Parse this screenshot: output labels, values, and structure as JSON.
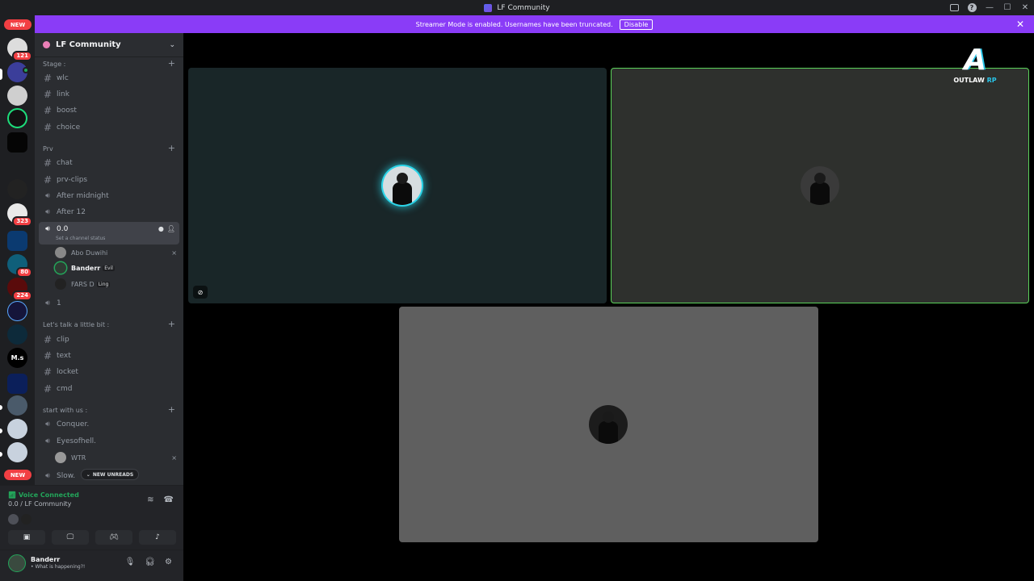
{
  "window": {
    "title": "LF Community"
  },
  "banner": {
    "message": "Streamer Mode is enabled. Usernames have been truncated.",
    "disable_label": "Disable"
  },
  "rail": {
    "new_top": "NEW",
    "new_bottom": "NEW",
    "badges": [
      "121",
      "323",
      "80",
      "224"
    ],
    "text_server": "M.s"
  },
  "server": {
    "name": "LF Community"
  },
  "categories": [
    {
      "name": "Stage :"
    },
    {
      "name": "Prv"
    },
    {
      "name": "Let's talk a little bit :"
    },
    {
      "name": "start with us :"
    }
  ],
  "channels": {
    "stage": [
      "wlc",
      "link",
      "boost",
      "choice"
    ],
    "prv_text": [
      "chat",
      "prv-clips"
    ],
    "prv_voice": [
      "After midnight",
      "After 12"
    ],
    "active": {
      "name": "0.0",
      "status": "Set a channel status"
    },
    "voice_users": [
      {
        "name": "Abo Duwihi",
        "tag": ""
      },
      {
        "name": "Banderr",
        "tag": "Evil"
      },
      {
        "name": "FARS D",
        "tag": "Ling"
      }
    ],
    "after_active": "1",
    "talk": [
      "clip",
      "text",
      "locket",
      "cmd"
    ],
    "start_voice": [
      "Conquer.",
      "Eyesofhell."
    ],
    "start_user": "WTR",
    "last": "Slow."
  },
  "new_unreads": "NEW UNREADS",
  "voice_panel": {
    "status": "Voice Connected",
    "channel": "0.0 / LF Community"
  },
  "user_panel": {
    "name": "Banderr",
    "status": "• What is happening?!"
  },
  "logo": {
    "main": "OUTLAW",
    "accent": "RP"
  },
  "colors": {
    "brand": "#5865f2",
    "banner": "#8a3cf7",
    "speaking": "#23a55a",
    "badge": "#f23f43"
  }
}
